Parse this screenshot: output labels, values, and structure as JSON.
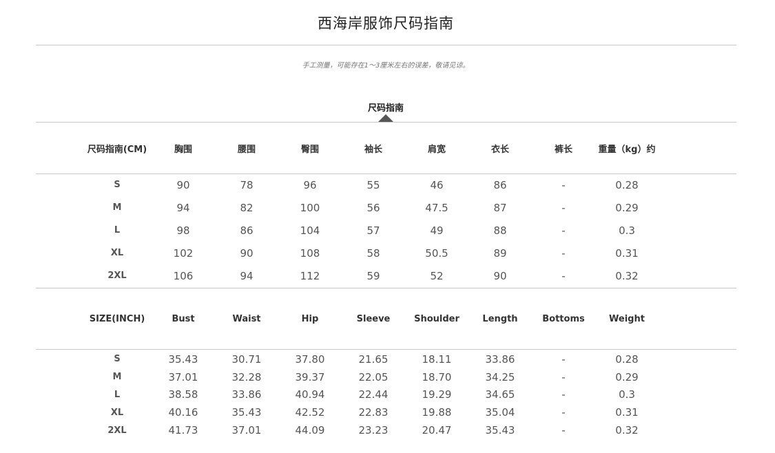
{
  "title": "西海岸服饰尺码指南",
  "note": "手工测量，可能存在1～3厘米左右的误差，敬请见谅。",
  "section_label": "尺码指南",
  "cm_table": {
    "headers": [
      "尺码指南(CM)",
      "胸围",
      "腰围",
      "臀围",
      "袖长",
      "肩宽",
      "衣长",
      "裤长",
      "重量（kg）约"
    ],
    "rows": [
      [
        "S",
        "90",
        "78",
        "96",
        "55",
        "46",
        "86",
        "-",
        "0.28"
      ],
      [
        "M",
        "94",
        "82",
        "100",
        "56",
        "47.5",
        "87",
        "-",
        "0.29"
      ],
      [
        "L",
        "98",
        "86",
        "104",
        "57",
        "49",
        "88",
        "-",
        "0.3"
      ],
      [
        "XL",
        "102",
        "90",
        "108",
        "58",
        "50.5",
        "89",
        "-",
        "0.31"
      ],
      [
        "2XL",
        "106",
        "94",
        "112",
        "59",
        "52",
        "90",
        "-",
        "0.32"
      ]
    ]
  },
  "inch_table": {
    "headers": [
      "SIZE(INCH)",
      "Bust",
      "Waist",
      "Hip",
      "Sleeve",
      "Shoulder",
      "Length",
      "Bottoms",
      "Weight"
    ],
    "rows": [
      [
        "S",
        "35.43",
        "30.71",
        "37.80",
        "21.65",
        "18.11",
        "33.86",
        "-",
        "0.28"
      ],
      [
        "M",
        "37.01",
        "32.28",
        "39.37",
        "22.05",
        "18.70",
        "34.25",
        "-",
        "0.29"
      ],
      [
        "L",
        "38.58",
        "33.86",
        "40.94",
        "22.44",
        "19.29",
        "34.65",
        "-",
        "0.3"
      ],
      [
        "XL",
        "40.16",
        "35.43",
        "42.52",
        "22.83",
        "19.88",
        "35.04",
        "-",
        "0.31"
      ],
      [
        "2XL",
        "41.73",
        "37.01",
        "44.09",
        "23.23",
        "20.47",
        "35.43",
        "-",
        "0.32"
      ]
    ]
  }
}
